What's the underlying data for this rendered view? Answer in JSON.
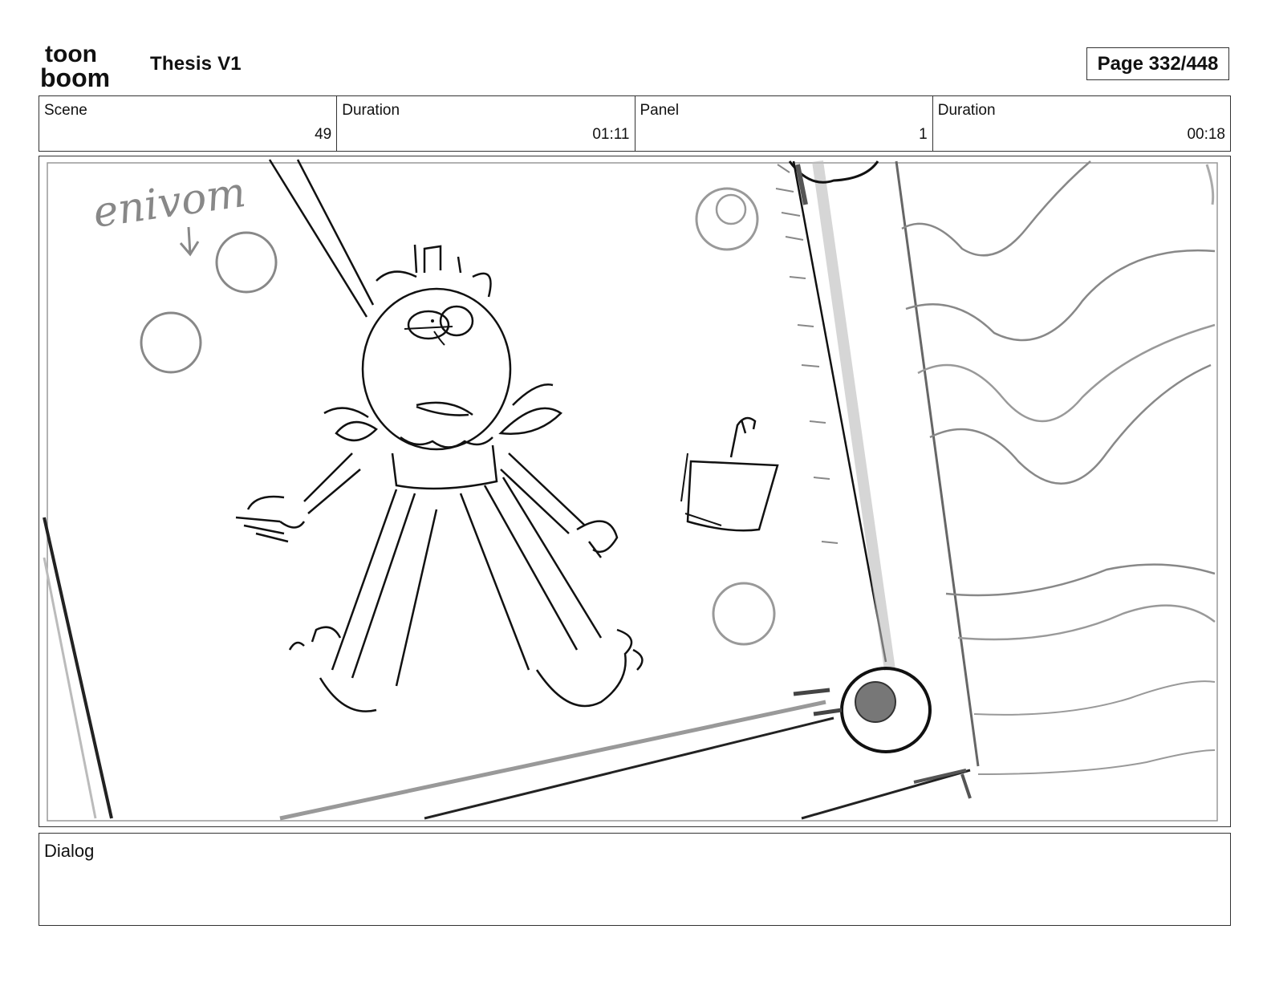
{
  "header": {
    "logo_line1": "toon",
    "logo_line2": "boom",
    "project_title": "Thesis V1",
    "page_indicator": "Page 332/448"
  },
  "info": {
    "scene_label": "Scene",
    "scene_value": "49",
    "scene_duration_label": "Duration",
    "scene_duration_value": "01:11",
    "panel_label": "Panel",
    "panel_value": "1",
    "panel_duration_label": "Duration",
    "panel_duration_value": "00:18"
  },
  "sketch": {
    "annotation": "enivom"
  },
  "dialog": {
    "label": "Dialog",
    "text": ""
  }
}
